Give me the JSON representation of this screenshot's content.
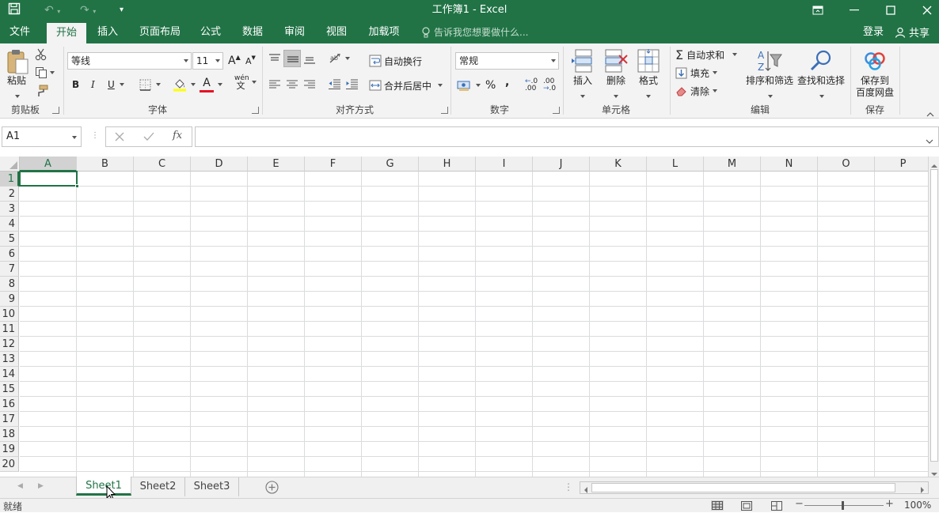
{
  "window": {
    "title": "工作簿1 - Excel",
    "accent": "#217346"
  },
  "tabs": [
    {
      "label": "文件"
    },
    {
      "label": "开始"
    },
    {
      "label": "插入"
    },
    {
      "label": "页面布局"
    },
    {
      "label": "公式"
    },
    {
      "label": "数据"
    },
    {
      "label": "审阅"
    },
    {
      "label": "视图"
    },
    {
      "label": "加载项"
    }
  ],
  "tell_me": {
    "placeholder": "告诉我您想要做什么..."
  },
  "account": {
    "signin": "登录",
    "share": "共享"
  },
  "ribbon": {
    "clipboard": {
      "paste": "粘贴",
      "group": "剪贴板"
    },
    "font": {
      "name": "等线",
      "size": "11",
      "bold": "B",
      "italic": "I",
      "underline": "U",
      "grow": "A",
      "shrink": "A",
      "font_color": "A",
      "phonetic_top": "wén",
      "phonetic_bottom": "文",
      "group": "字体"
    },
    "alignment": {
      "wrap": "自动换行",
      "merge": "合并后居中",
      "group": "对齐方式"
    },
    "number": {
      "format": "常规",
      "percent": "%",
      "comma": ",",
      "inc_decimal": ".00",
      "dec_decimal": ".00",
      "group": "数字"
    },
    "cells": {
      "insert": "插入",
      "delete": "删除",
      "format": "格式",
      "group": "单元格"
    },
    "editing": {
      "autosum": "自动求和",
      "fill": "填充",
      "clear": "清除",
      "sort": "排序和筛选",
      "find": "查找和选择",
      "group": "编辑"
    },
    "save": {
      "label_line1": "保存到",
      "label_line2": "百度网盘",
      "group": "保存"
    }
  },
  "formula_bar": {
    "name_box": "A1",
    "fx": "fx",
    "content": ""
  },
  "grid": {
    "columns": [
      "A",
      "B",
      "C",
      "D",
      "E",
      "F",
      "G",
      "H",
      "I",
      "J",
      "K",
      "L",
      "M",
      "N",
      "O",
      "P"
    ],
    "rows": [
      "1",
      "2",
      "3",
      "4",
      "5",
      "6",
      "7",
      "8",
      "9",
      "10",
      "11",
      "12",
      "13",
      "14",
      "15",
      "16",
      "17",
      "18",
      "19",
      "20"
    ],
    "selected_cell": "A1"
  },
  "sheets": [
    {
      "label": "Sheet1",
      "active": true
    },
    {
      "label": "Sheet2",
      "active": false
    },
    {
      "label": "Sheet3",
      "active": false
    }
  ],
  "status": {
    "ready": "就绪",
    "zoom": "100%"
  }
}
